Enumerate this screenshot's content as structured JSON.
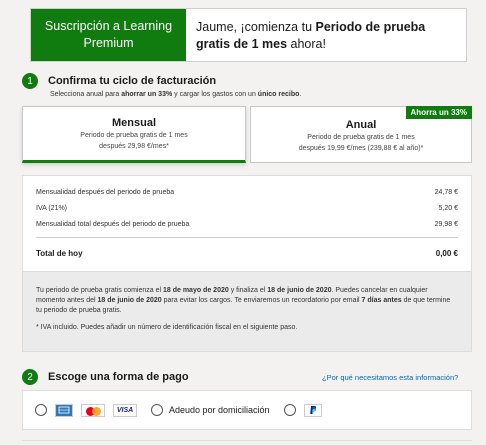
{
  "header": {
    "banner": "Suscripción a Learning Premium",
    "greeting_prefix": "Jaume, ¡comienza tu ",
    "greeting_bold": "Periodo de prueba gratis de 1 mes",
    "greeting_suffix": " ahora!"
  },
  "step1": {
    "number": "1",
    "title": "Confirma tu ciclo de facturación",
    "subtitle_prefix": "Selecciona anual para ",
    "subtitle_bold1": "ahorrar un 33%",
    "subtitle_mid": " y cargar los gastos con un ",
    "subtitle_bold2": "único recibo",
    "subtitle_suffix": "."
  },
  "plans": {
    "monthly": {
      "title": "Mensual",
      "line1": "Periodo de prueba gratis de 1 mes",
      "line2": "después 29,98 €/mes*"
    },
    "annual": {
      "title": "Anual",
      "line1": "Periodo de prueba gratis de 1 mes",
      "line2": "después 19,99 €/mes (239,88 € al año)*",
      "badge": "Ahorra un 33%"
    }
  },
  "breakdown": {
    "rows": [
      {
        "label": "Mensualidad después del periodo de prueba",
        "value": "24,78 €"
      },
      {
        "label": "IVA (21%)",
        "value": "5,20 €"
      },
      {
        "label": "Mensualidad total después del periodo de prueba",
        "value": "29,98 €"
      }
    ],
    "total_label": "Total de hoy",
    "total_value": "0,00 €"
  },
  "info": {
    "p1_a": "Tu periodo de prueba gratis comienza el ",
    "p1_b": "18 de mayo de 2020",
    "p1_c": " y finaliza el ",
    "p1_d": "18 de junio de 2020",
    "p1_e": ". Puedes cancelar en cualquier momento antes del ",
    "p1_f": "18 de junio de 2020",
    "p1_g": " para evitar los cargos. Te enviaremos un recordatorio por email ",
    "p1_h": "7 días antes",
    "p1_i": " de que termine tu periodo de prueba gratis.",
    "note": "* IVA incluido. Puedes añadir un número de identificación fiscal en el siguiente paso."
  },
  "step2": {
    "number": "2",
    "title": "Escoge una forma de pago",
    "why_link": "¿Por qué necesitamos esta información?"
  },
  "payment": {
    "cards_icons": [
      "amex-icon",
      "mastercard-icon",
      "visa-icon"
    ],
    "visa_text": "VISA",
    "adeudo_label": "Adeudo por domiciliación",
    "paypal_icon": "paypal-icon"
  },
  "colors": {
    "accent": "#107c10",
    "link": "#0067b8",
    "background": "#f3f2f1"
  }
}
